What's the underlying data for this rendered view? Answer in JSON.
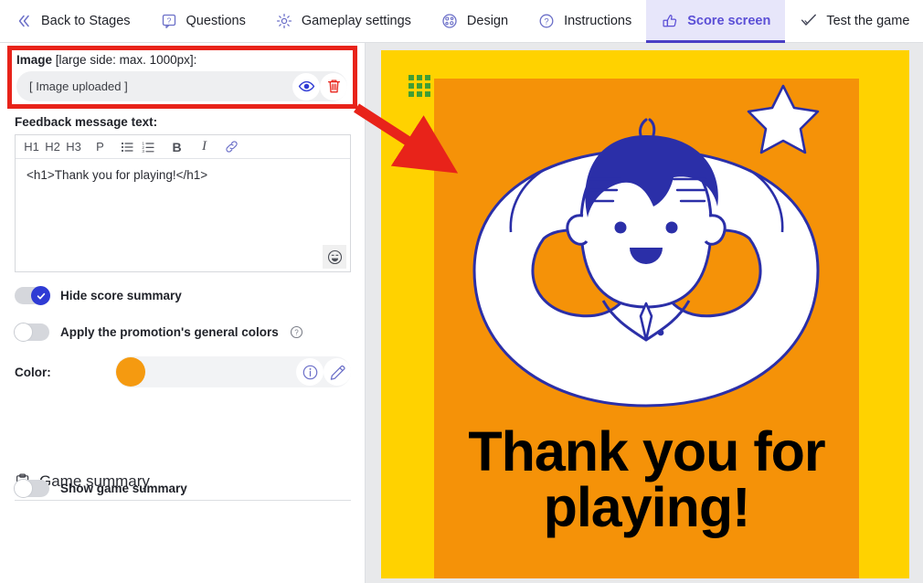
{
  "tabs": [
    {
      "label": "Back to Stages",
      "icon": "chevron-double-left-icon",
      "active": false
    },
    {
      "label": "Questions",
      "icon": "question-bubble-icon",
      "active": false
    },
    {
      "label": "Gameplay settings",
      "icon": "gear-icon",
      "active": false
    },
    {
      "label": "Design",
      "icon": "palette-icon",
      "active": false
    },
    {
      "label": "Instructions",
      "icon": "question-circle-icon",
      "active": false
    },
    {
      "label": "Score screen",
      "icon": "thumbs-up-icon",
      "active": true
    },
    {
      "label": "Test the game",
      "icon": "check-icon",
      "active": false
    }
  ],
  "image_section": {
    "label_bold": "Image",
    "label_hint": "[large side: max. 1000px]:",
    "uploaded_text": "[ Image uploaded ]",
    "preview_icon": "eye-icon",
    "delete_icon": "trash-icon"
  },
  "feedback": {
    "label": "Feedback message text:",
    "toolbar": [
      "H1",
      "H2",
      "H3",
      "P",
      "bullet-list-icon",
      "numbered-list-icon",
      "B",
      "I",
      "link-icon"
    ],
    "content": "<h1>Thank you for playing!</h1>",
    "emoji_icon": "smiley-icon"
  },
  "toggles": [
    {
      "label": "Hide score summary",
      "on": true
    },
    {
      "label": "Apply the promotion's general colors",
      "on": false,
      "help_icon": "question-circle-icon"
    }
  ],
  "color": {
    "label": "Color:",
    "value": "#f59a10",
    "info_icon": "info-icon",
    "edit_icon": "pencil-icon"
  },
  "game_summary": {
    "heading": "Game summary",
    "heading_icon": "clipboard-icon",
    "toggle_label": "Show game summary",
    "toggle_on": false
  },
  "preview": {
    "background_color": "#ffd200",
    "card_color": "#f59208",
    "grid_icon": "grid-3x3-icon",
    "headline_line1": "Thank you for",
    "headline_line2": "playing!",
    "illustration": "person-with-arms-behind-head-and-star"
  },
  "annotations": {
    "highlight_box_color": "#e8231a",
    "arrow_color": "#e8231a"
  }
}
